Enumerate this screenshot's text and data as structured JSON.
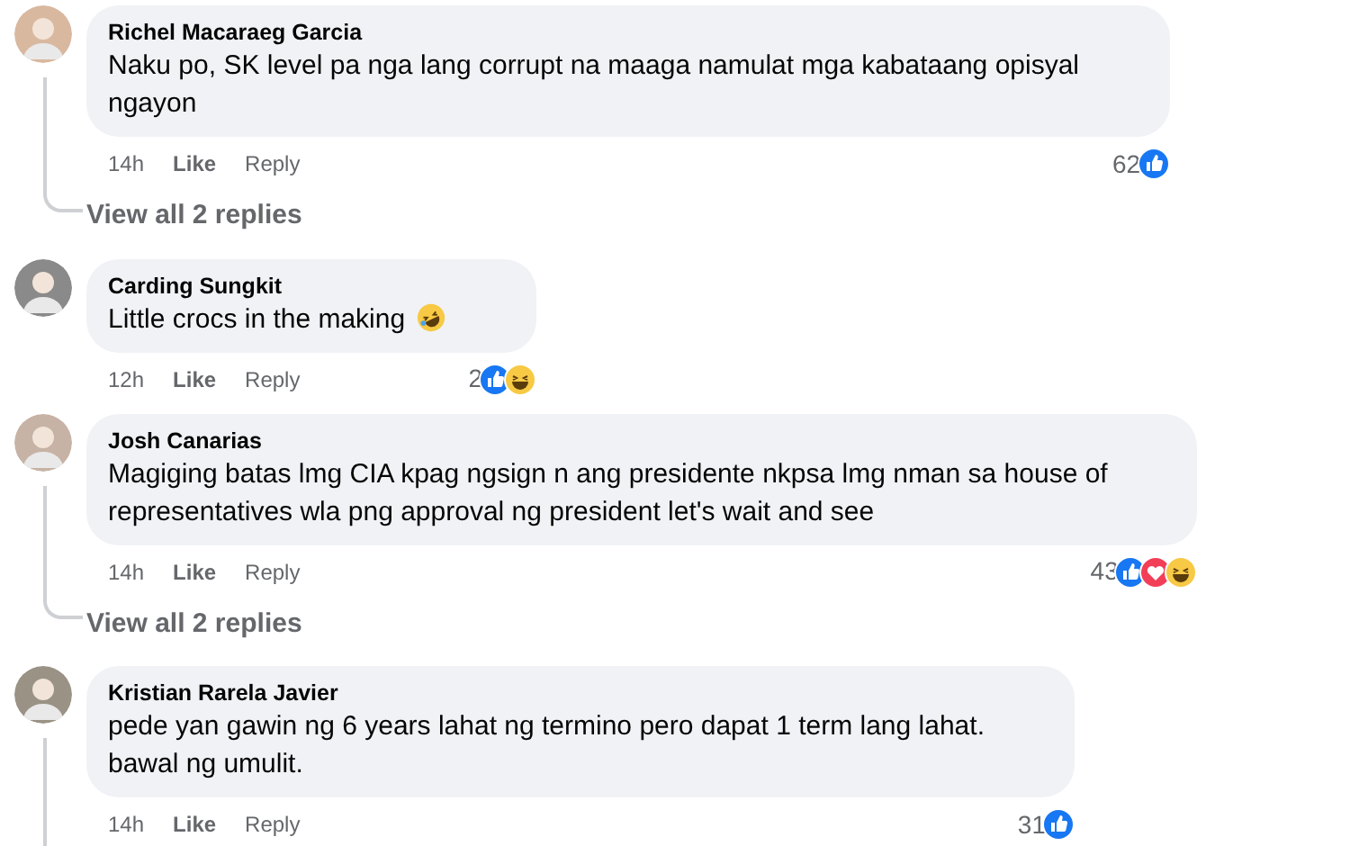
{
  "comments": [
    {
      "name": "Richel Macaraeg Garcia",
      "text": "Naku po, SK level pa nga lang corrupt na maaga namulat mga kabataang opisyal\nngayon",
      "time": "14h",
      "like": "Like",
      "reply": "Reply",
      "reaction_count": "62",
      "reactions": [
        {
          "kind": "like"
        }
      ],
      "view_replies": "View all 2 replies"
    },
    {
      "name": "Carding Sungkit",
      "text": "Little crocs in the making",
      "emoji": {
        "kind": "rofl"
      },
      "time": "12h",
      "like": "Like",
      "reply": "Reply",
      "reaction_count": "2",
      "reactions": [
        {
          "kind": "like"
        },
        {
          "kind": "haha"
        }
      ]
    },
    {
      "name": "Josh Canarias",
      "text": "Magiging batas lmg CIA kpag ngsign n ang presidente nkpsa lmg nman sa house of\nrepresentatives wla png approval ng president let's wait and see",
      "time": "14h",
      "like": "Like",
      "reply": "Reply",
      "reaction_count": "43",
      "reactions": [
        {
          "kind": "like"
        },
        {
          "kind": "love"
        },
        {
          "kind": "haha"
        }
      ],
      "view_replies": "View all 2 replies"
    },
    {
      "name": "Kristian Rarela Javier",
      "text": "pede yan gawin ng 6 years lahat ng termino pero dapat 1 term lang lahat.\nbawal ng umulit.",
      "time": "14h",
      "like": "Like",
      "reply": "Reply",
      "reaction_count": "31",
      "reactions": [
        {
          "kind": "like"
        }
      ]
    }
  ]
}
